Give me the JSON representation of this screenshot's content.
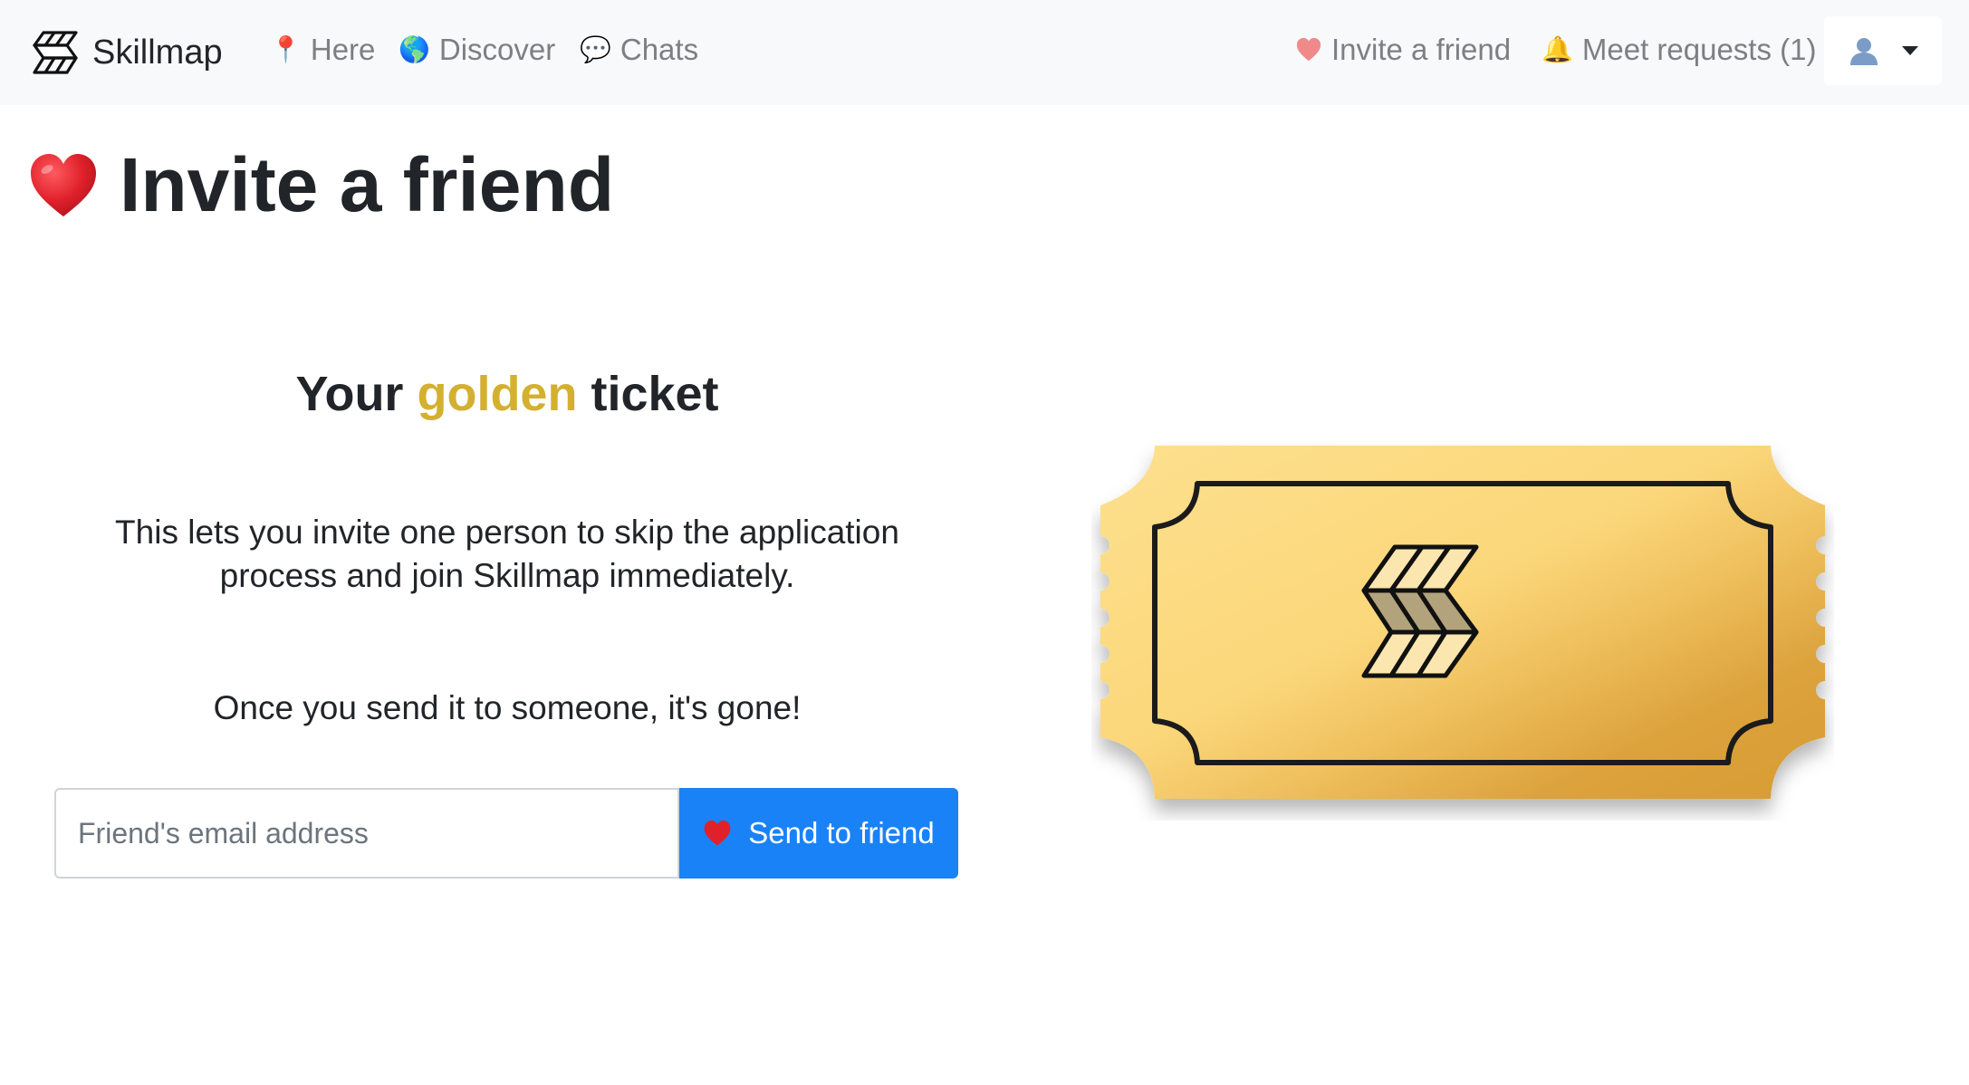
{
  "navbar": {
    "brand": {
      "name": "Skillmap",
      "icon": "skillmap-logo-icon"
    },
    "links": [
      {
        "label": "Here",
        "icon": "pin-icon",
        "emoji": "📍"
      },
      {
        "label": "Discover",
        "icon": "globe-icon",
        "emoji": "🌎"
      },
      {
        "label": "Chats",
        "icon": "speech-bubble-icon",
        "emoji": "💬"
      }
    ],
    "right_links": [
      {
        "label": "Invite a friend",
        "icon": "heart-icon",
        "emoji": "❤️"
      },
      {
        "label": "Meet requests (1)",
        "icon": "bell-icon",
        "emoji": "🔔"
      }
    ],
    "user_menu": {
      "icon": "user-avatar-icon"
    }
  },
  "page": {
    "title": "Invite a friend",
    "title_icon": "heart-icon"
  },
  "ticket_section": {
    "title_before": "Your",
    "title_highlight": "golden",
    "title_after": "ticket",
    "description": "This lets you invite one person to skip the application process and join Skillmap immediately.",
    "warning": "Once you send it to someone, it's gone!",
    "email_placeholder": "Friend's email address",
    "email_value": "",
    "send_label": "Send to friend",
    "send_icon": "heart-icon"
  },
  "colors": {
    "accent": "#1a82f7",
    "gold": "#d4b030",
    "navbar_bg": "#f8f9fa",
    "heart": "#e0212b"
  }
}
